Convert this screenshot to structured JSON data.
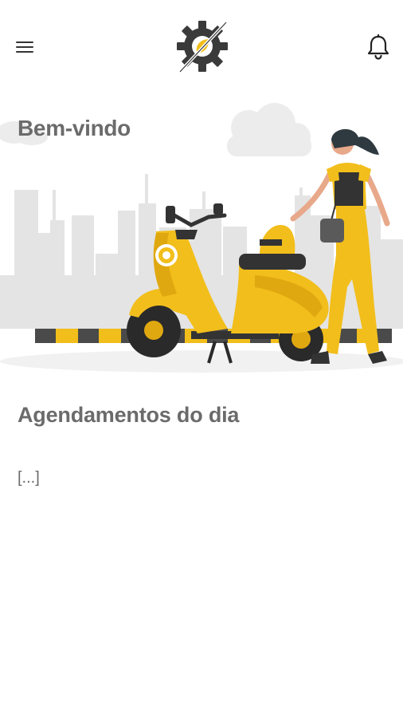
{
  "header": {
    "menu_icon": "hamburger-menu-icon",
    "logo_icon": "gear-leaf-logo",
    "notification_icon": "bell-icon"
  },
  "hero": {
    "welcome_text": "Bem-vindo",
    "illustration": "woman-walking-with-yellow-scooter"
  },
  "schedule": {
    "title": "Agendamentos do dia",
    "placeholder": "[...]"
  },
  "colors": {
    "accent_yellow": "#F2BE1B",
    "text_gray": "#6B6B6B",
    "dark": "#333333"
  }
}
